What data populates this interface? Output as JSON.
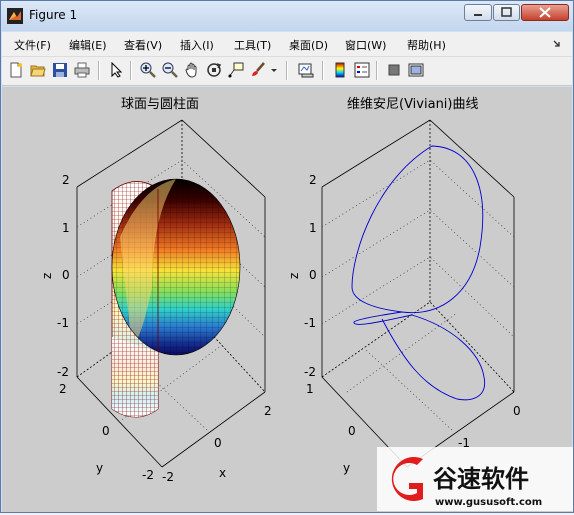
{
  "window": {
    "title": "Figure 1"
  },
  "menu": [
    {
      "label": "文件(F)"
    },
    {
      "label": "编辑(E)"
    },
    {
      "label": "查看(V)"
    },
    {
      "label": "插入(I)"
    },
    {
      "label": "工具(T)"
    },
    {
      "label": "桌面(D)"
    },
    {
      "label": "窗口(W)"
    },
    {
      "label": "帮助(H)"
    }
  ],
  "toolbar": {
    "buttons": [
      "new-figure",
      "open-file",
      "save-figure",
      "print-figure",
      "edit-plot-arrow",
      "zoom-in",
      "zoom-out",
      "pan-hand",
      "rotate-3d",
      "data-cursor",
      "brush",
      "link-plot",
      "colorbar",
      "legend",
      "hide-plot-tools",
      "show-plot-tools"
    ]
  },
  "axes_left": {
    "title": "球面与圆柱面",
    "zlabel": "z",
    "xlabel": "x",
    "ylabel": "y",
    "zticks": [
      "2",
      "1",
      "0",
      "-1",
      "-2"
    ],
    "xticks": [
      "-2",
      "0",
      "2"
    ],
    "yticks": [
      "2",
      "0",
      "-2"
    ]
  },
  "axes_right": {
    "title": "维维安尼(Viviani)曲线",
    "zlabel": "z",
    "ylabel": "y",
    "zticks": [
      "2",
      "1",
      "0",
      "-1",
      "-2"
    ],
    "xticks": [
      "0",
      "-1"
    ],
    "yticks": [
      "1",
      "0"
    ],
    "line_color": "#0000cc"
  },
  "watermark": {
    "name": "谷速软件",
    "url": "www.gususoft.com"
  },
  "chart_data": [
    {
      "type": "surface",
      "title": "球面与圆柱面",
      "xlabel": "x",
      "ylabel": "y",
      "zlabel": "z",
      "xlim": [
        -2,
        2
      ],
      "ylim": [
        -2,
        2
      ],
      "zlim": [
        -2,
        2
      ],
      "surfaces": [
        "sphere radius 2",
        "cylinder radius 1 centred at (1,0)"
      ]
    },
    {
      "type": "line3d",
      "title": "维维安尼(Viviani)曲线",
      "ylabel": "y",
      "zlabel": "z",
      "zlim": [
        -2,
        2
      ],
      "series": [
        {
          "color": "#0000cc"
        }
      ]
    }
  ]
}
